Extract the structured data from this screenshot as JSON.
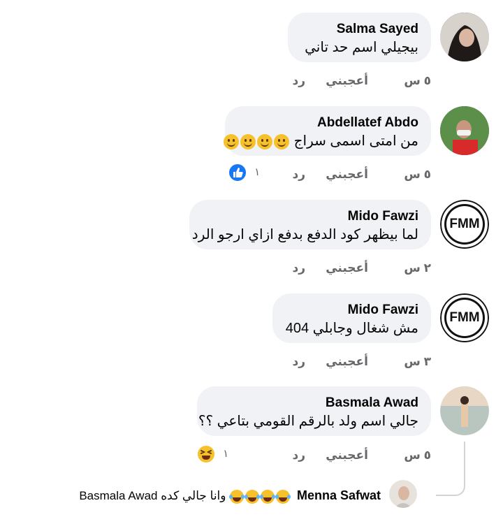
{
  "actions": {
    "like": "أعجبني",
    "reply": "رد"
  },
  "comments": [
    {
      "author": "Salma Sayed",
      "text": "بيجيلي اسم حد تاني",
      "time": "٥ س"
    },
    {
      "author": "Abdellatef Abdo",
      "text": "من امتى اسمى سراج",
      "time": "٥ س",
      "reaction_count": "١",
      "reaction_type": "like-icon"
    },
    {
      "author": "Mido Fawzi",
      "text": "لما بيظهر كود الدفع بدفع ازاي ارجو الرد",
      "time": "٢ س",
      "avatar_text": "FMM"
    },
    {
      "author": "Mido Fawzi",
      "text": "مش شغال وجابلي 404",
      "time": "٣ س",
      "avatar_text": "FMM"
    },
    {
      "author": "Basmala Awad",
      "text": "جالي اسم ولد بالرقم القومي بتاعي ؟؟",
      "time": "٥ س",
      "reaction_count": "١",
      "reaction_type": "haha-icon"
    }
  ],
  "reply": {
    "author": "Menna Safwat",
    "text_tail": "وانا جالي كده",
    "mention": "Basmala Awad"
  },
  "colors": {
    "bubble": "#f0f2f5",
    "meta": "#65676b",
    "like_blue": "#1877f2"
  }
}
